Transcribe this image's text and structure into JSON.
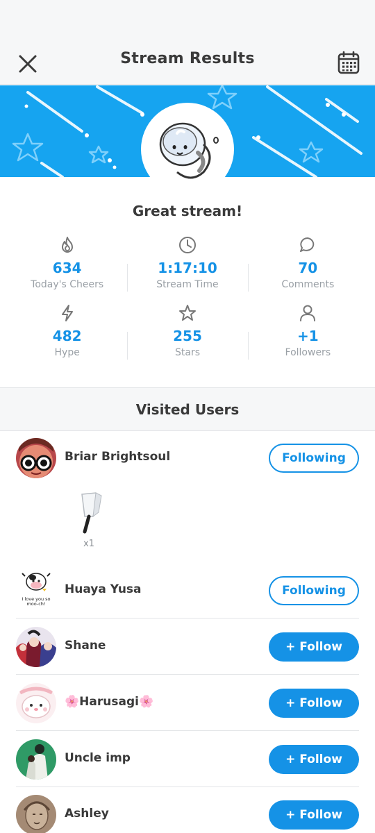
{
  "header": {
    "title": "Stream Results",
    "close_icon": "close-icon",
    "calendar_icon": "calendar-icon"
  },
  "colors": {
    "accent": "#1592e6",
    "banner": "#16a4f0"
  },
  "summary": {
    "message": "Great stream!"
  },
  "stats": [
    {
      "icon": "fire-icon",
      "value": "634",
      "label": "Today's Cheers"
    },
    {
      "icon": "clock-icon",
      "value": "1:17:10",
      "label": "Stream Time"
    },
    {
      "icon": "comment-icon",
      "value": "70",
      "label": "Comments"
    },
    {
      "icon": "lightning-icon",
      "value": "482",
      "label": "Hype"
    },
    {
      "icon": "star-icon",
      "value": "255",
      "label": "Stars"
    },
    {
      "icon": "person-icon",
      "value": "+1",
      "label": "Followers"
    }
  ],
  "visited": {
    "title": "Visited Users",
    "users": [
      {
        "name": "Briar Brightsoul",
        "button": "Following",
        "gift_qty": "x1"
      },
      {
        "name": "Huaya Yusa",
        "button": "Following",
        "avatar_caption": "I love you so moo-ch!"
      },
      {
        "name": "Shane",
        "button": "+ Follow"
      },
      {
        "name": "🌸Harusagi🌸",
        "button": "+ Follow"
      },
      {
        "name": "Uncle imp",
        "button": "+ Follow"
      },
      {
        "name": "Ashley",
        "button": "+ Follow"
      }
    ]
  }
}
